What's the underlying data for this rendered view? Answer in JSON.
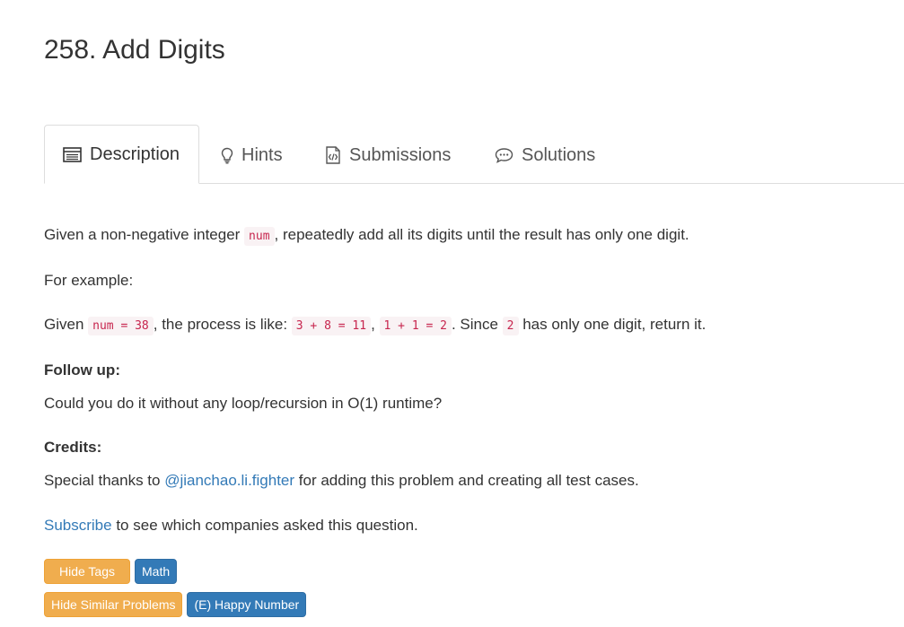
{
  "problem": {
    "title": "258. Add Digits"
  },
  "tabs": [
    {
      "label": "Description",
      "icon": "list-icon",
      "active": true
    },
    {
      "label": "Hints",
      "icon": "lightbulb-icon",
      "active": false
    },
    {
      "label": "Submissions",
      "icon": "code-file-icon",
      "active": false
    },
    {
      "label": "Solutions",
      "icon": "speech-bubble-icon",
      "active": false
    }
  ],
  "description": {
    "intro_pre": "Given a non-negative integer ",
    "intro_code": "num",
    "intro_post": ", repeatedly add all its digits until the result has only one digit.",
    "example_label": "For example:",
    "example_pre": "Given ",
    "example_code1": "num = 38",
    "example_mid1": ", the process is like: ",
    "example_code2": "3 + 8 = 11",
    "example_mid2": ", ",
    "example_code3": "1 + 1 = 2",
    "example_mid3": ". Since ",
    "example_code4": "2",
    "example_post": " has only one digit, return it.",
    "followup_heading": "Follow up:",
    "followup_text": "Could you do it without any loop/recursion in O(1) runtime?",
    "credits_heading": "Credits:",
    "credits_pre": "Special thanks to ",
    "credits_link": "@jianchao.li.fighter",
    "credits_post": " for adding this problem and creating all test cases.",
    "subscribe_link": "Subscribe",
    "subscribe_post": " to see which companies asked this question."
  },
  "tags": {
    "hide_tags_label": "Hide Tags",
    "items": [
      "Math"
    ]
  },
  "similar": {
    "hide_similar_label": "Hide Similar Problems",
    "items": [
      "(E) Happy Number"
    ]
  },
  "colors": {
    "link": "#337ab7",
    "code_text": "#c7254e",
    "code_bg": "#f9f2f4",
    "warning_button": "#f0ad4e",
    "primary_label": "#337ab7"
  }
}
